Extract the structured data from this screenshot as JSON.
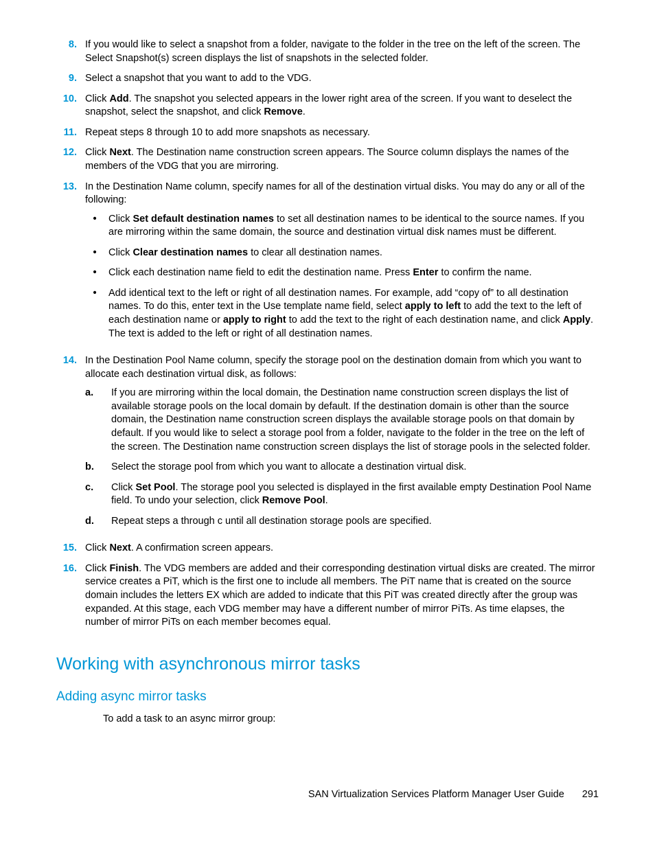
{
  "steps": {
    "s8": {
      "num": "8.",
      "text": "If you would like to select a snapshot from a folder, navigate to the folder in the tree on the left of the screen. The Select Snapshot(s) screen displays the list of snapshots in the selected folder."
    },
    "s9": {
      "num": "9.",
      "text": "Select a snapshot that you want to add to the VDG."
    },
    "s10": {
      "num": "10.",
      "pre": "Click ",
      "b1": "Add",
      "mid": ". The snapshot you selected appears in the lower right area of the screen. If you want to deselect the snapshot, select the snapshot, and click ",
      "b2": "Remove",
      "post": "."
    },
    "s11": {
      "num": "11.",
      "text": "Repeat steps 8 through 10 to add more snapshots as necessary."
    },
    "s12": {
      "num": "12.",
      "pre": "Click ",
      "b1": "Next",
      "post": ". The Destination name construction screen appears. The Source column displays the names of the members of the VDG that you are mirroring."
    },
    "s13": {
      "num": "13.",
      "text": "In the Destination Name column, specify names for all of the destination virtual disks. You may do any or all of the following:",
      "b1": {
        "pre": "Click ",
        "b": "Set default destination names",
        "post": " to set all destination names to be identical to the source names. If you are mirroring within the same domain, the source and destination virtual disk names must be different."
      },
      "b2": {
        "pre": "Click ",
        "b": "Clear destination names",
        "post": " to clear all destination names."
      },
      "b3": {
        "pre": "Click each destination name field to edit the destination name. Press ",
        "b": "Enter",
        "post": " to confirm the name."
      },
      "b4": {
        "pre": "Add identical text to the left or right of all destination names. For example, add “copy of” to all destination names. To do this, enter text in the Use template name field, select ",
        "b1": "apply to left",
        "mid1": " to add the text to the left of each destination name or ",
        "b2": "apply to right",
        "mid2": " to add the text to the right of each destination name, and click ",
        "b3": "Apply",
        "post": ". The text is added to the left or right of all destination names."
      }
    },
    "s14": {
      "num": "14.",
      "text": "In the Destination Pool Name column, specify the storage pool on the destination domain from which you want to allocate each destination virtual disk, as follows:",
      "a": {
        "l": "a.",
        "text": "If you are mirroring within the local domain, the Destination name construction screen displays the list of available storage pools on the local domain by default. If the destination domain is other than the source domain, the Destination name construction screen displays the available storage pools on that domain by default. If you would like to select a storage pool from a folder, navigate to the folder in the tree on the left of the screen. The Destination name construction screen displays the list of storage pools in the selected folder."
      },
      "b": {
        "l": "b.",
        "text": "Select the storage pool from which you want to allocate a destination virtual disk."
      },
      "c": {
        "l": "c.",
        "pre": "Click ",
        "b1": "Set Pool",
        "mid": ". The storage pool you selected is displayed in the first available empty Destination Pool Name field. To undo your selection, click ",
        "b2": "Remove Pool",
        "post": "."
      },
      "d": {
        "l": "d.",
        "text": "Repeat steps a through c until all destination storage pools are specified."
      }
    },
    "s15": {
      "num": "15.",
      "pre": "Click ",
      "b1": "Next",
      "post": ". A confirmation screen appears."
    },
    "s16": {
      "num": "16.",
      "pre": "Click ",
      "b1": "Finish",
      "post": ". The VDG members are added and their corresponding destination virtual disks are created. The mirror service creates a PiT, which is the first one to include all members. The PiT name that is created on the source domain includes the letters EX which are added to indicate that this PiT was created directly after the group was expanded. At this stage, each VDG member may have a different number of mirror PiTs. As time elapses, the number of mirror PiTs on each member becomes equal."
    }
  },
  "headings": {
    "h2": "Working with asynchronous mirror tasks",
    "h3": "Adding async mirror tasks",
    "intro": "To add a task to an async mirror group:"
  },
  "footer": {
    "title": "SAN Virtualization Services Platform Manager User Guide",
    "page": "291"
  }
}
